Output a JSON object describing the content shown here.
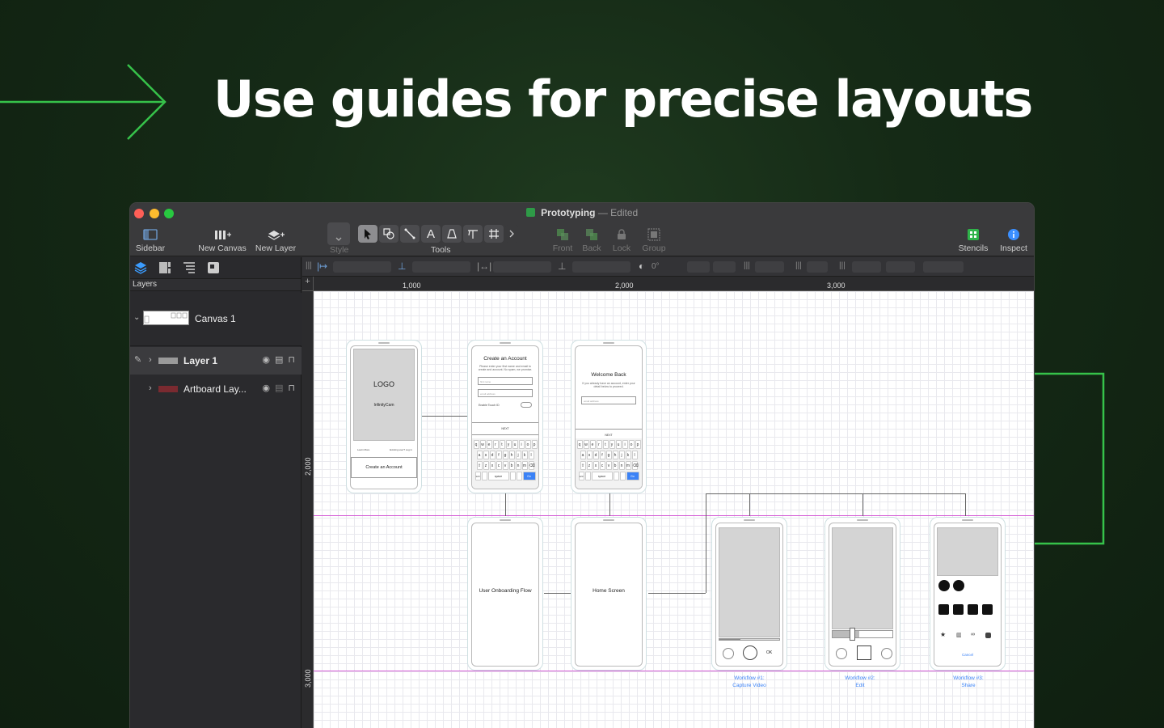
{
  "hero": {
    "title": "Use guides for precise layouts"
  },
  "window": {
    "doc_name": "Prototyping",
    "doc_separator": "—",
    "doc_status": "Edited"
  },
  "toolbar": {
    "sidebar_label": "Sidebar",
    "new_canvas_label": "New Canvas",
    "new_layer_label": "New Layer",
    "style_label": "Style",
    "tools_label": "Tools",
    "front_label": "Front",
    "back_label": "Back",
    "lock_label": "Lock",
    "group_label": "Group",
    "stencils_label": "Stencils",
    "inspect_label": "Inspect",
    "text_tool_glyph": "A"
  },
  "sidebar": {
    "section_title": "Layers",
    "canvas_name": "Canvas 1",
    "layers": [
      {
        "name": "Layer 1",
        "selected": true,
        "swatch": "#9a9a9a"
      },
      {
        "name": "Artboard Lay...",
        "selected": false,
        "swatch": "#7a2a30"
      }
    ]
  },
  "format_bar": {
    "rotation": "0°"
  },
  "rulers": {
    "top": [
      "1,000",
      "2,000",
      "3,000"
    ],
    "left": [
      "2,000",
      "3,000"
    ]
  },
  "canvas": {
    "screens": {
      "launch": {
        "logo": "LOGO",
        "app_name": "InfinityCam",
        "link_left": "Learn More",
        "link_right": "Existing user? Log in",
        "button": "Create an Account"
      },
      "create_account": {
        "title": "Create an Account",
        "subtitle": "Please enter your first name and email to create and account. No spam, we promise.",
        "field1": "first name",
        "field2": "email address",
        "toggle_label": "Enable Touch ID",
        "button": "NEXT"
      },
      "welcome_back": {
        "title": "Welcome Back",
        "subtitle": "If you already have an account, enter your detail below to proceed.",
        "field1": "email address",
        "button": "NEXT"
      },
      "onboarding": {
        "label": "User Onboarding Flow"
      },
      "home": {
        "label": "Home Screen"
      },
      "capture": {
        "ok_label": "OK"
      },
      "share": {
        "cancel_label": "Cancel"
      }
    },
    "keyboard": {
      "row1": [
        "q",
        "w",
        "e",
        "r",
        "t",
        "y",
        "u",
        "i",
        "o",
        "p"
      ],
      "row2": [
        "a",
        "s",
        "d",
        "f",
        "g",
        "h",
        "j",
        "k",
        "l"
      ],
      "row3": [
        "⇧",
        "z",
        "x",
        "c",
        "v",
        "b",
        "n",
        "m",
        "⌫"
      ],
      "row4_left": "123",
      "row4_space": "space",
      "row4_go": "Go"
    },
    "captions": [
      {
        "line1": "Workflow #1:",
        "line2": "Capture Video"
      },
      {
        "line1": "Workflow #2:",
        "line2": "Edit"
      },
      {
        "line1": "Workflow #3:",
        "line2": "Share"
      }
    ]
  },
  "colors": {
    "accent_green": "#36c24a",
    "guide_magenta": "#d45ad6",
    "link_blue": "#3b82f6"
  }
}
